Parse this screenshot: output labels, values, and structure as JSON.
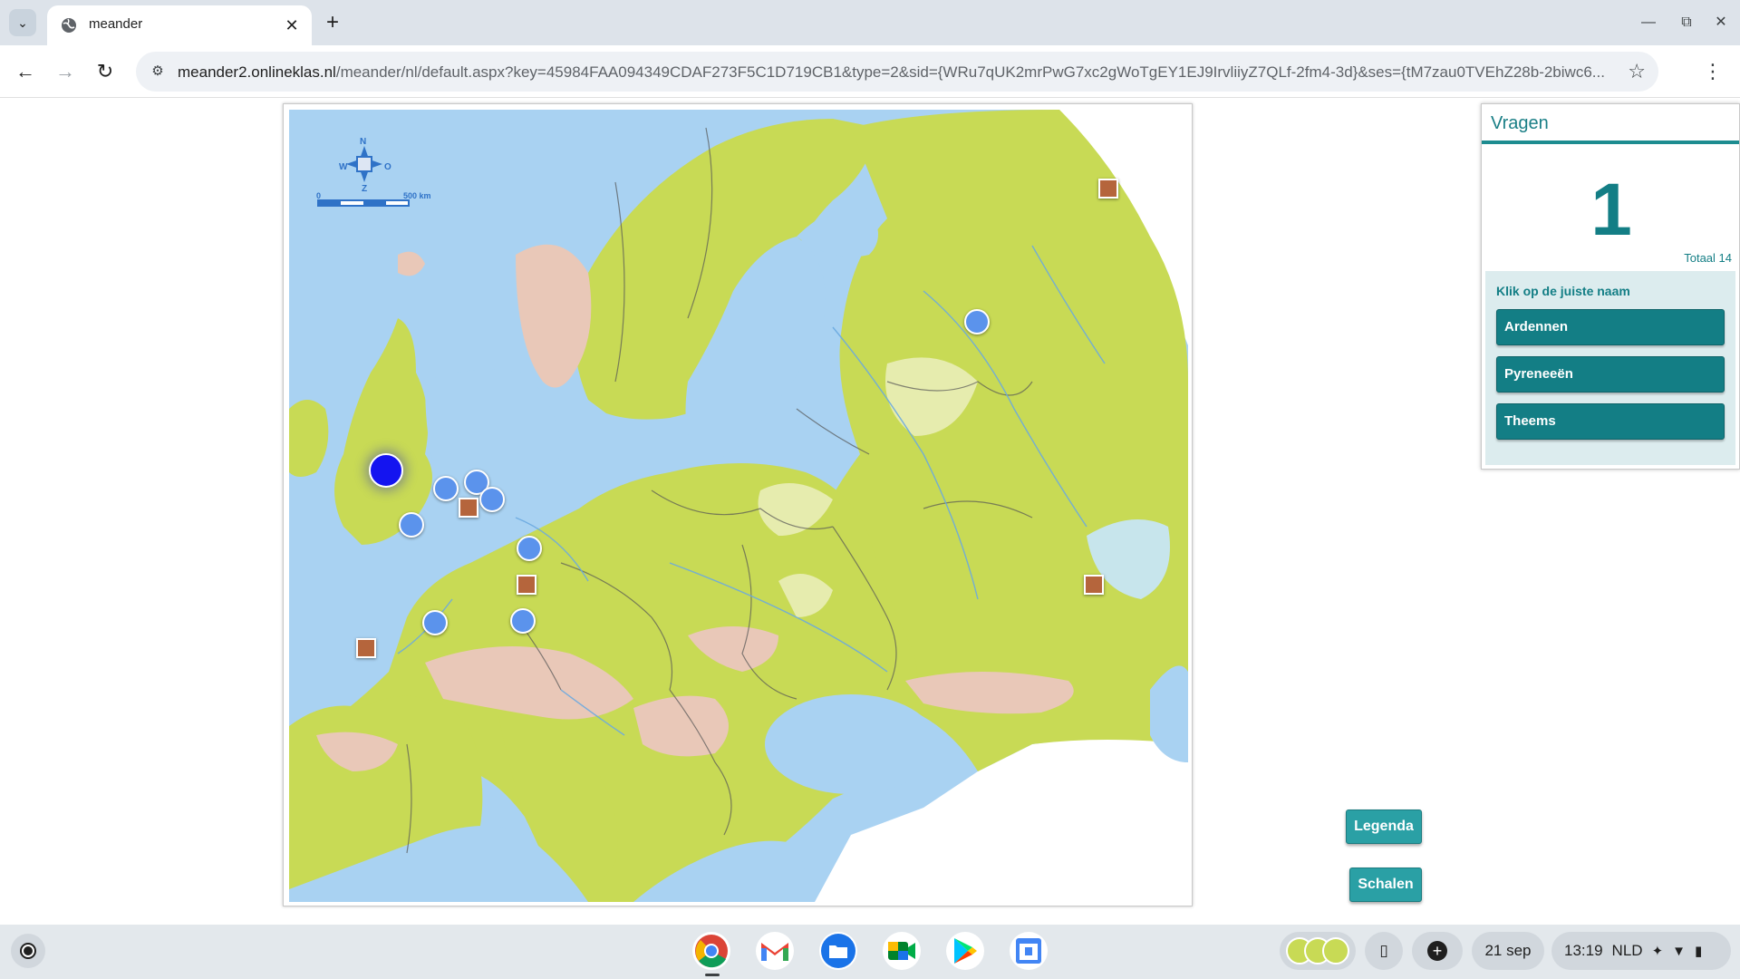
{
  "browser": {
    "tab_title": "meander",
    "url_host": "meander2.onlineklas.nl",
    "url_rest": "/meander/nl/default.aspx?key=45984FAA094349CDAF273F5C1D719CB1&type=2&sid={WRu7qUK2mrPwG7xc2gWoTgEY1EJ9IrvliiyZ7QLf-2fm4-3d}&ses={tM7zau0TVEhZ28b-2biwc6..."
  },
  "map": {
    "compass": {
      "n": "N",
      "w": "W",
      "o": "O",
      "z": "Z"
    },
    "scale": {
      "zero": "0",
      "max": "500 km"
    },
    "colors": {
      "sea": "#a9d2f2",
      "lowland": "#c8da55",
      "highland": "#e9c8b8",
      "plain": "#e6ecae"
    }
  },
  "questions": {
    "title": "Vragen",
    "number": "1",
    "total": "Totaal 14",
    "instruction": "Klik op de juiste naam",
    "answers": [
      "Ardennen",
      "Pyreneeën",
      "Theems"
    ]
  },
  "buttons": {
    "legend": "Legenda",
    "scale": "Schalen"
  },
  "shelf": {
    "date": "21 sep",
    "time": "13:19",
    "lang": "NLD"
  }
}
